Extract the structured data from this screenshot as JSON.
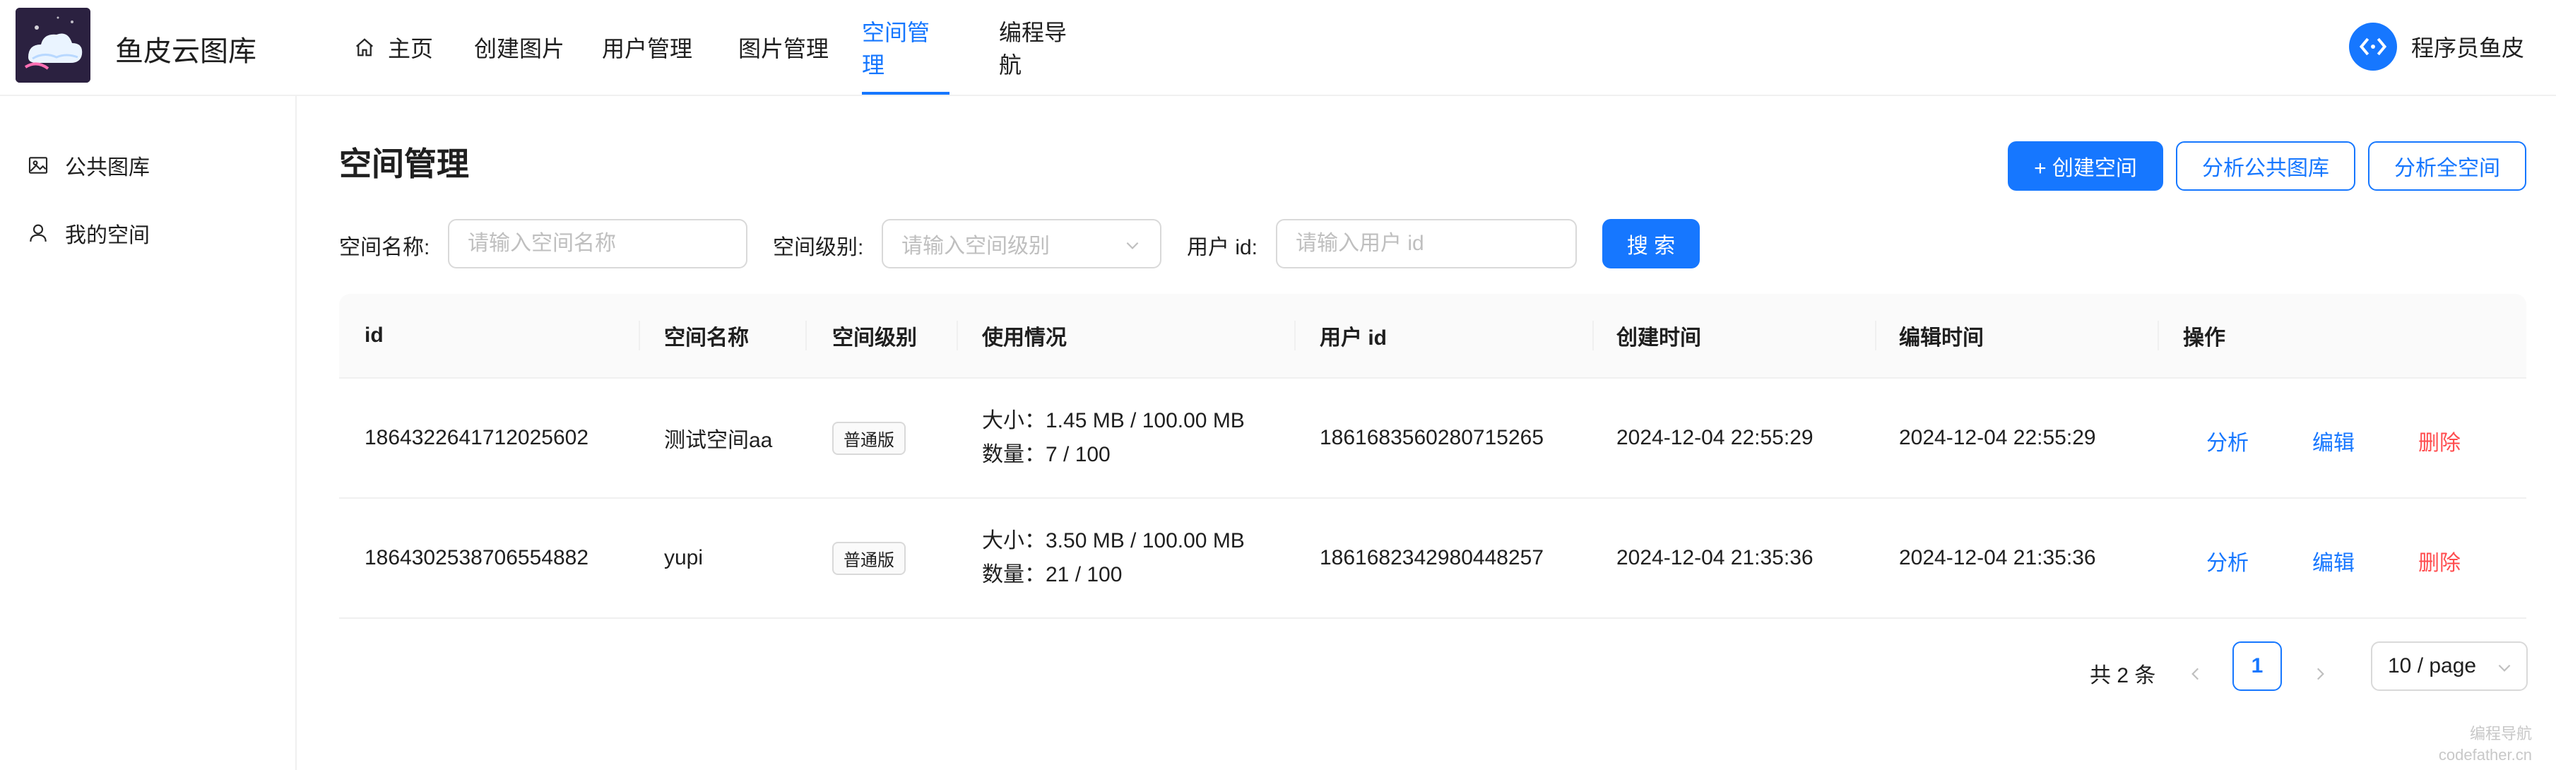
{
  "header": {
    "brand": "鱼皮云图库",
    "nav": [
      {
        "label": "主页",
        "icon": "home-icon"
      },
      {
        "label": "创建图片"
      },
      {
        "label": "用户管理"
      },
      {
        "label": "图片管理"
      },
      {
        "label": "空间管理",
        "active": true
      },
      {
        "label": "编程导航"
      }
    ],
    "user_name": "程序员鱼皮"
  },
  "sidebar": {
    "items": [
      {
        "label": "公共图库",
        "icon": "picture-icon"
      },
      {
        "label": "我的空间",
        "icon": "user-icon"
      }
    ]
  },
  "page": {
    "title": "空间管理",
    "create_button": "+ 创建空间",
    "analyze_public_button": "分析公共图库",
    "analyze_all_button": "分析全空间"
  },
  "search": {
    "space_name_label": "空间名称:",
    "space_name_placeholder": "请输入空间名称",
    "space_level_label": "空间级别:",
    "space_level_placeholder": "请输入空间级别",
    "user_id_label": "用户 id:",
    "user_id_placeholder": "请输入用户 id",
    "search_button": "搜 索"
  },
  "table": {
    "columns": [
      "id",
      "空间名称",
      "空间级别",
      "使用情况",
      "用户 id",
      "创建时间",
      "编辑时间",
      "操作"
    ],
    "rows": [
      {
        "id": "1864322641712025602",
        "name": "测试空间aa",
        "level": "普通版",
        "size": "大小：1.45 MB / 100.00 MB",
        "count": "数量：7 / 100",
        "user_id": "1861683560280715265",
        "create_time": "2024-12-04 22:55:29",
        "edit_time": "2024-12-04 22:55:29"
      },
      {
        "id": "1864302538706554882",
        "name": "yupi",
        "level": "普通版",
        "size": "大小：3.50 MB / 100.00 MB",
        "count": "数量：21 / 100",
        "user_id": "1861682342980448257",
        "create_time": "2024-12-04 21:35:36",
        "edit_time": "2024-12-04 21:35:36"
      }
    ],
    "actions": {
      "analyze": "分析",
      "edit": "编辑",
      "delete": "删除"
    }
  },
  "pagination": {
    "total": "共 2 条",
    "current_page": "1",
    "page_size": "10 / page"
  },
  "watermark": {
    "line1": "编程导航",
    "line2": "codefather.cn"
  },
  "colors": {
    "primary": "#1677ff",
    "danger": "#ff4d4f",
    "border": "#d9d9d9"
  }
}
